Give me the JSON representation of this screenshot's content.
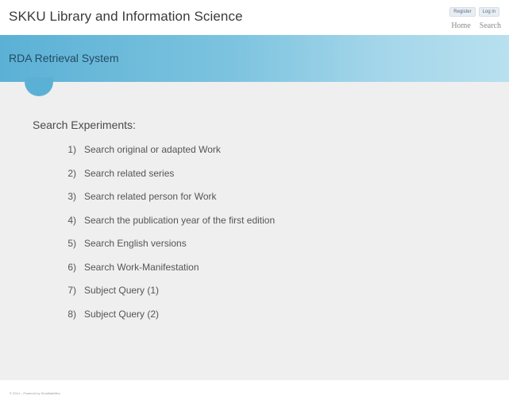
{
  "header": {
    "site_title": "SKKU Library and Information Science",
    "account": {
      "register_label": "Register",
      "login_label": "Log in"
    },
    "nav": {
      "home_label": "Home",
      "search_label": "Search"
    }
  },
  "banner": {
    "title": "RDA Retrieval System"
  },
  "main": {
    "heading": "Search Experiments:",
    "experiments": [
      {
        "num": "1)",
        "label": "Search original or adapted Work"
      },
      {
        "num": "2)",
        "label": "Search related series"
      },
      {
        "num": "3)",
        "label": "Search related person for Work"
      },
      {
        "num": "4)",
        "label": "Search the publication year of the first edition"
      },
      {
        "num": "5)",
        "label": "Search English versions"
      },
      {
        "num": "6)",
        "label": "Search Work-Manifestation"
      },
      {
        "num": "7)",
        "label": "Subject Query (1)"
      },
      {
        "num": "8)",
        "label": "Subject Query (2)"
      }
    ]
  },
  "footer": {
    "text": "© 2014 – Powered by Smalltalk/Mvc"
  },
  "colors": {
    "banner_start": "#5bb1d5",
    "banner_end": "#b8e0ef",
    "content_bg": "#efefef",
    "banner_title": "#244a63"
  }
}
